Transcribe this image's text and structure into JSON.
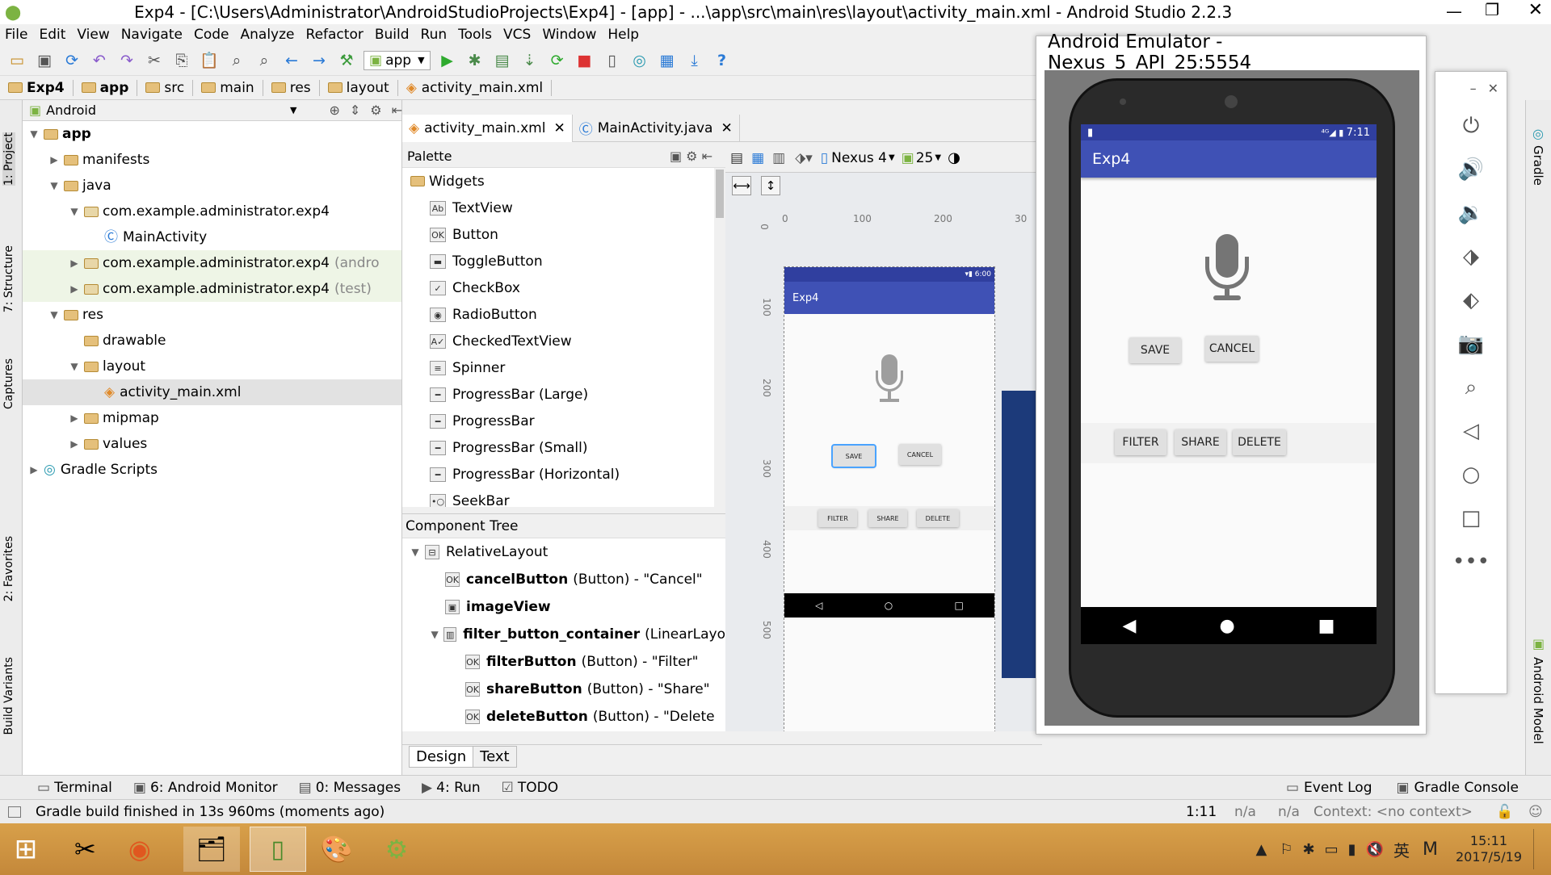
{
  "window": {
    "title": "Exp4 - [C:\\Users\\Administrator\\AndroidStudioProjects\\Exp4] - [app] - ...\\app\\src\\main\\res\\layout\\activity_main.xml - Android Studio 2.2.3"
  },
  "menu": [
    "File",
    "Edit",
    "View",
    "Navigate",
    "Code",
    "Analyze",
    "Refactor",
    "Build",
    "Run",
    "Tools",
    "VCS",
    "Window",
    "Help"
  ],
  "toolbar": {
    "run_config": "app"
  },
  "breadcrumb": [
    "Exp4",
    "app",
    "src",
    "main",
    "res",
    "layout",
    "activity_main.xml"
  ],
  "side_tabs_left": [
    "1: Project",
    "7: Structure",
    "Captures",
    "2: Favorites",
    "Build Variants"
  ],
  "side_tabs_right": [
    "Gradle",
    "Android Model"
  ],
  "project": {
    "view": "Android",
    "tree": [
      {
        "label": "app",
        "indent": 0,
        "icon": "folder",
        "arrow": "▼",
        "bold": true
      },
      {
        "label": "manifests",
        "indent": 1,
        "icon": "folder",
        "arrow": "▶"
      },
      {
        "label": "java",
        "indent": 1,
        "icon": "folder",
        "arrow": "▼"
      },
      {
        "label": "com.example.administrator.exp4",
        "indent": 2,
        "icon": "package",
        "arrow": "▼"
      },
      {
        "label": "MainActivity",
        "indent": 3,
        "icon": "class",
        "arrow": ""
      },
      {
        "label": "com.example.administrator.exp4",
        "suffix": "(andro",
        "indent": 2,
        "icon": "package",
        "arrow": "▶",
        "hl": true
      },
      {
        "label": "com.example.administrator.exp4",
        "suffix": "(test)",
        "indent": 2,
        "icon": "package",
        "arrow": "▶",
        "hl": true
      },
      {
        "label": "res",
        "indent": 1,
        "icon": "folder",
        "arrow": "▼"
      },
      {
        "label": "drawable",
        "indent": 2,
        "icon": "folder",
        "arrow": ""
      },
      {
        "label": "layout",
        "indent": 2,
        "icon": "folder",
        "arrow": "▼"
      },
      {
        "label": "activity_main.xml",
        "indent": 3,
        "icon": "xml",
        "arrow": "",
        "selected": true
      },
      {
        "label": "mipmap",
        "indent": 2,
        "icon": "folder",
        "arrow": "▶"
      },
      {
        "label": "values",
        "indent": 2,
        "icon": "folder",
        "arrow": "▶"
      },
      {
        "label": "Gradle Scripts",
        "indent": 0,
        "icon": "gradle",
        "arrow": "▶"
      }
    ]
  },
  "editor_tabs": [
    "activity_main.xml",
    "MainActivity.java"
  ],
  "palette": {
    "title": "Palette",
    "group": "Widgets",
    "items": [
      {
        "icon": "Ab",
        "label": "TextView"
      },
      {
        "icon": "OK",
        "label": "Button"
      },
      {
        "icon": "▬",
        "label": "ToggleButton"
      },
      {
        "icon": "✓",
        "label": "CheckBox"
      },
      {
        "icon": "◉",
        "label": "RadioButton"
      },
      {
        "icon": "A✓",
        "label": "CheckedTextView"
      },
      {
        "icon": "≡",
        "label": "Spinner"
      },
      {
        "icon": "━",
        "label": "ProgressBar (Large)"
      },
      {
        "icon": "━",
        "label": "ProgressBar"
      },
      {
        "icon": "━",
        "label": "ProgressBar (Small)"
      },
      {
        "icon": "━",
        "label": "ProgressBar (Horizontal)"
      },
      {
        "icon": "•○",
        "label": "SeekBar"
      }
    ]
  },
  "component_tree": {
    "title": "Component Tree",
    "items": [
      {
        "name": "RelativeLayout",
        "detail": "",
        "indent": 0
      },
      {
        "name": "cancelButton",
        "detail": "(Button) - \"Cancel\"",
        "indent": 1
      },
      {
        "name": "imageView",
        "detail": "",
        "indent": 1
      },
      {
        "name": "filter_button_container",
        "detail": "(LinearLayo",
        "indent": 1
      },
      {
        "name": "filterButton",
        "detail": "(Button) - \"Filter\"",
        "indent": 2
      },
      {
        "name": "shareButton",
        "detail": "(Button) - \"Share\"",
        "indent": 2
      },
      {
        "name": "deleteButton",
        "detail": "(Button) - \"Delete",
        "indent": 2
      }
    ]
  },
  "design_toolbar": {
    "device": "Nexus 4",
    "api": "25"
  },
  "ruler": {
    "h": [
      "0",
      "100",
      "200",
      "30"
    ],
    "v": [
      "0",
      "100",
      "200",
      "300",
      "400",
      "500"
    ]
  },
  "preview": {
    "time": "6:00",
    "app_title": "Exp4",
    "save": "SAVE",
    "cancel": "CANCEL",
    "filter": "FILTER",
    "share": "SHARE",
    "delete": "DELETE"
  },
  "bottom_tabs": [
    "Design",
    "Text"
  ],
  "tool_windows_left": [
    "Terminal",
    "6: Android Monitor",
    "0: Messages",
    "4: Run",
    "TODO"
  ],
  "tool_windows_right": [
    "Event Log",
    "Gradle Console"
  ],
  "status": {
    "message": "Gradle build finished in 13s 960ms (moments ago)",
    "position": "1:11",
    "na1": "n/a",
    "na2": "n/a",
    "context": "Context: <no context>"
  },
  "emulator": {
    "title": "Android Emulator - Nexus_5_API_25:5554",
    "time": "7:11",
    "app_title": "Exp4",
    "save": "SAVE",
    "cancel": "CANCEL",
    "filter": "FILTER",
    "share": "SHARE",
    "delete": "DELETE"
  },
  "taskbar": {
    "time": "15:11",
    "date": "2017/5/19",
    "ime": "英"
  }
}
